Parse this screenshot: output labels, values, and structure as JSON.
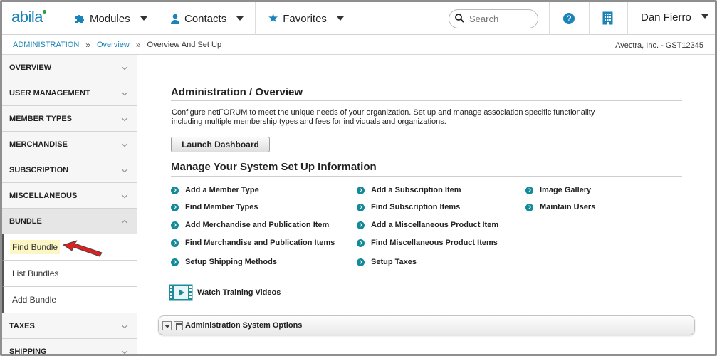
{
  "brand": {
    "logo_text": "abila"
  },
  "nav": {
    "modules": "Modules",
    "contacts": "Contacts",
    "favorites": "Favorites",
    "search_placeholder": "Search",
    "help_label": "?",
    "user": "Dan Fierro"
  },
  "breadcrumb": {
    "items": [
      "ADMINISTRATION",
      "Overview",
      "Overview And Set Up"
    ],
    "separator": "»",
    "org": "Avectra, Inc. - GST12345"
  },
  "sidebar": {
    "sections": [
      "OVERVIEW",
      "USER MANAGEMENT",
      "MEMBER TYPES",
      "MERCHANDISE",
      "SUBSCRIPTION",
      "MISCELLANEOUS",
      "BUNDLE",
      "TAXES",
      "SHIPPING"
    ],
    "open_section": "BUNDLE",
    "bundle_items": [
      "Find Bundle",
      "List Bundles",
      "Add Bundle"
    ],
    "highlighted_item": "Find Bundle"
  },
  "main": {
    "title": "Administration / Overview",
    "description": "Configure netFORUM to meet the unique needs of your organization. Set up and manage association specific functionality including multiple membership types and fees for individuals and organizations.",
    "launch_button": "Launch Dashboard",
    "manage_title": "Manage Your System Set Up Information",
    "links_col1": [
      "Add a Member Type",
      "Find Member Types",
      "Add Merchandise and Publication Item",
      "Find Merchandise and Publication Items",
      "Setup Shipping Methods"
    ],
    "links_col2": [
      "Add a Subscription Item",
      "Find Subscription Items",
      "Add a Miscellaneous Product Item",
      "Find Miscellaneous Product Items",
      "Setup Taxes"
    ],
    "links_col3": [
      "Image Gallery",
      "Maintain Users"
    ],
    "training_link": "Watch Training Videos",
    "options_bar": "Administration System Options"
  },
  "colors": {
    "brand_blue": "#1a83b8",
    "bullet_teal": "#128a98",
    "highlight_yellow": "#fbf6c4",
    "arrow_red": "#e02020"
  }
}
